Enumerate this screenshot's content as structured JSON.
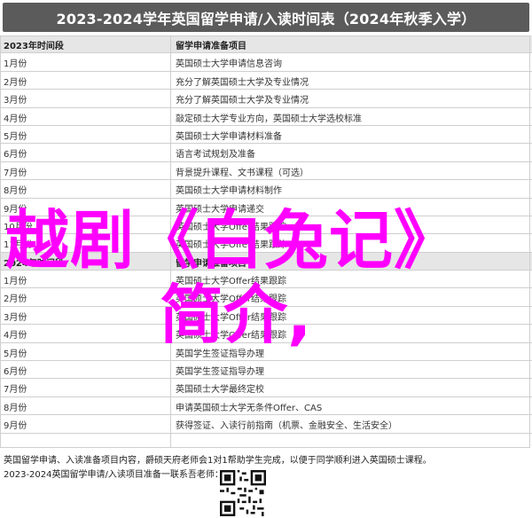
{
  "title": "2023-2024学年英国留学申请/入读时间表（2024年秋季入学）",
  "table": {
    "header": {
      "c1": "2023年时间段",
      "c2": "留学申请准备项目"
    },
    "rows": [
      {
        "c1": "1月份",
        "c2": "英国硕士大学申请信息咨询"
      },
      {
        "c1": "2月份",
        "c2": "充分了解英国硕士大学及专业情况"
      },
      {
        "c1": "3月份",
        "c2": "充分了解英国硕士大学及专业情况"
      },
      {
        "c1": "4月份",
        "c2": "敲定硕士大学专业方向，英国硕士大学选校标准"
      },
      {
        "c1": "5月份",
        "c2": "英国硕士大学申请材料准备"
      },
      {
        "c1": "6月份",
        "c2": "语言考试规划及准备"
      },
      {
        "c1": "7月份",
        "c2": "背景提升课程、文书课程（可选）"
      },
      {
        "c1": "8月份",
        "c2": "英国硕士大学申请材料制作"
      },
      {
        "c1": "9月份",
        "c2": "英国硕士大学申请递交"
      },
      {
        "c1": "10月份",
        "c2": "英国硕士大学Offer结果跟踪"
      },
      {
        "c1": "11月份",
        "c2": "英国硕士大学Offer结果跟踪"
      }
    ],
    "section2": {
      "c1": "2024年时间段",
      "c2": "留学申请准备项目"
    },
    "rows2": [
      {
        "c1": "1月份",
        "c2": "英国硕士大学Offer结果跟踪"
      },
      {
        "c1": "2月份",
        "c2": "英国硕士大学Offer结果跟踪"
      },
      {
        "c1": "3月份",
        "c2": "英国硕士大学Offer结果跟踪"
      },
      {
        "c1": "4月份",
        "c2": "英国硕士大学Offer结果跟踪"
      },
      {
        "c1": "5月份",
        "c2": "英国学生签证指导办理"
      },
      {
        "c1": "6月份",
        "c2": "英国学生签证指导办理"
      },
      {
        "c1": "7月份",
        "c2": "英国硕士大学最终定校"
      },
      {
        "c1": "8月份",
        "c2": "申请英国硕士大学无条件Offer、CAS"
      },
      {
        "c1": "9月份",
        "c2": "获得签证、入读行前指南（机票、金融安全、生活安全）"
      }
    ]
  },
  "footer": {
    "line1": "英国留学申请、入读准备项目内容，爵硕天府老师会1对1帮助学生完成，以便于同学顺利进入英国硕士课程。",
    "line2": "2023-2024英国留学申请/入读项目准备一联系吾老师："
  },
  "overlay": {
    "line1": "越剧《白兔记》",
    "line2": "简介,"
  },
  "colors": {
    "title_bg": "#5b5b5b",
    "overlay": "#ff00ff",
    "section_bg": "#e6e6e6"
  }
}
